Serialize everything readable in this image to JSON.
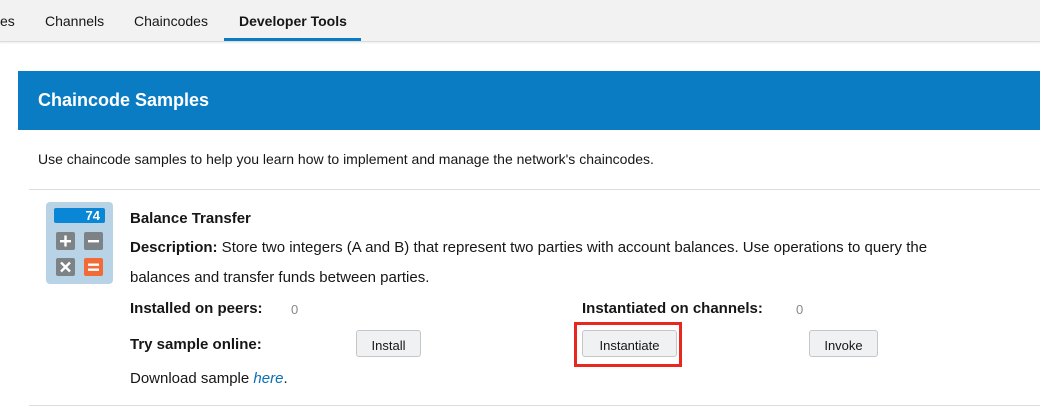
{
  "tabs": [
    {
      "label": "es"
    },
    {
      "label": "Channels"
    },
    {
      "label": "Chaincodes"
    },
    {
      "label": "Developer Tools",
      "active": true
    }
  ],
  "panel": {
    "title": "Chaincode Samples",
    "intro": "Use chaincode samples to help you learn how to implement and manage the network's chaincodes.",
    "header_color": "#0a7cc4"
  },
  "sample": {
    "icon_display_value": "74",
    "name": "Balance Transfer",
    "description_label": "Description:",
    "description_line1": " Store two integers (A and B) that represent two parties with account balances. Use operations to query the",
    "description_line2": "balances and transfer funds between parties.",
    "installed_label": "Installed on peers:",
    "installed_value": "0",
    "instantiated_label": "Instantiated on channels:",
    "instantiated_value": "0",
    "try_label": "Try sample online:",
    "install_button": "Install",
    "instantiate_button": "Instantiate",
    "invoke_button": "Invoke",
    "download_prefix": "Download sample ",
    "download_link": "here",
    "download_suffix": "."
  },
  "colors": {
    "accent": "#0a7cc4",
    "highlight": "#e8281e",
    "link": "#0a6fb5"
  }
}
